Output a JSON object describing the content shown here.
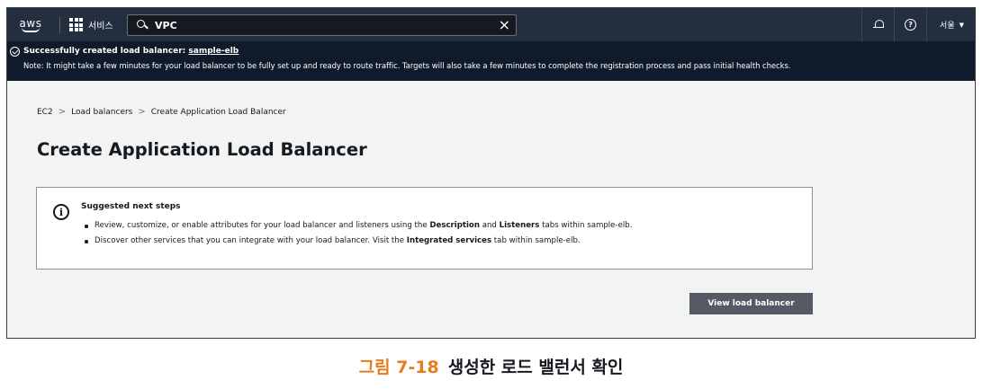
{
  "nav": {
    "logo_text": "aws",
    "services_label": "서비스",
    "search_value": "VPC",
    "clear_symbol": "×",
    "region_label": "서울",
    "help_symbol": "?"
  },
  "flash": {
    "title_prefix": "Successfully created load balancer: ",
    "title_link": "sample-elb",
    "note": "Note: It might take a few minutes for your load balancer to be fully set up and ready to route traffic. Targets will also take a few minutes to complete the registration process and pass initial health checks."
  },
  "breadcrumb": {
    "items": [
      "EC2",
      "Load balancers",
      "Create Application Load Balancer"
    ]
  },
  "page": {
    "title": "Create Application Load Balancer"
  },
  "info": {
    "icon_glyph": "i",
    "heading": "Suggested next steps",
    "item1": {
      "a": "Review, customize, or enable attributes for your load balancer and listeners using the ",
      "b": "Description",
      "c": " and ",
      "d": "Listeners",
      "e": " tabs within sample-elb."
    },
    "item2": {
      "a": "Discover other services that you can integrate with your load balancer. Visit the ",
      "b": "Integrated services",
      "c": " tab within sample-elb."
    }
  },
  "actions": {
    "view_button": "View load balancer"
  },
  "caption": {
    "number": "그림 7-18",
    "text": "생성한 로드 밸런서 확인"
  },
  "colors": {
    "nav_bg": "#232f3e",
    "flash_bg": "#0f1b2a",
    "page_bg": "#f2f3f3",
    "button_bg": "#545b64",
    "caption_accent": "#e67c1b"
  }
}
